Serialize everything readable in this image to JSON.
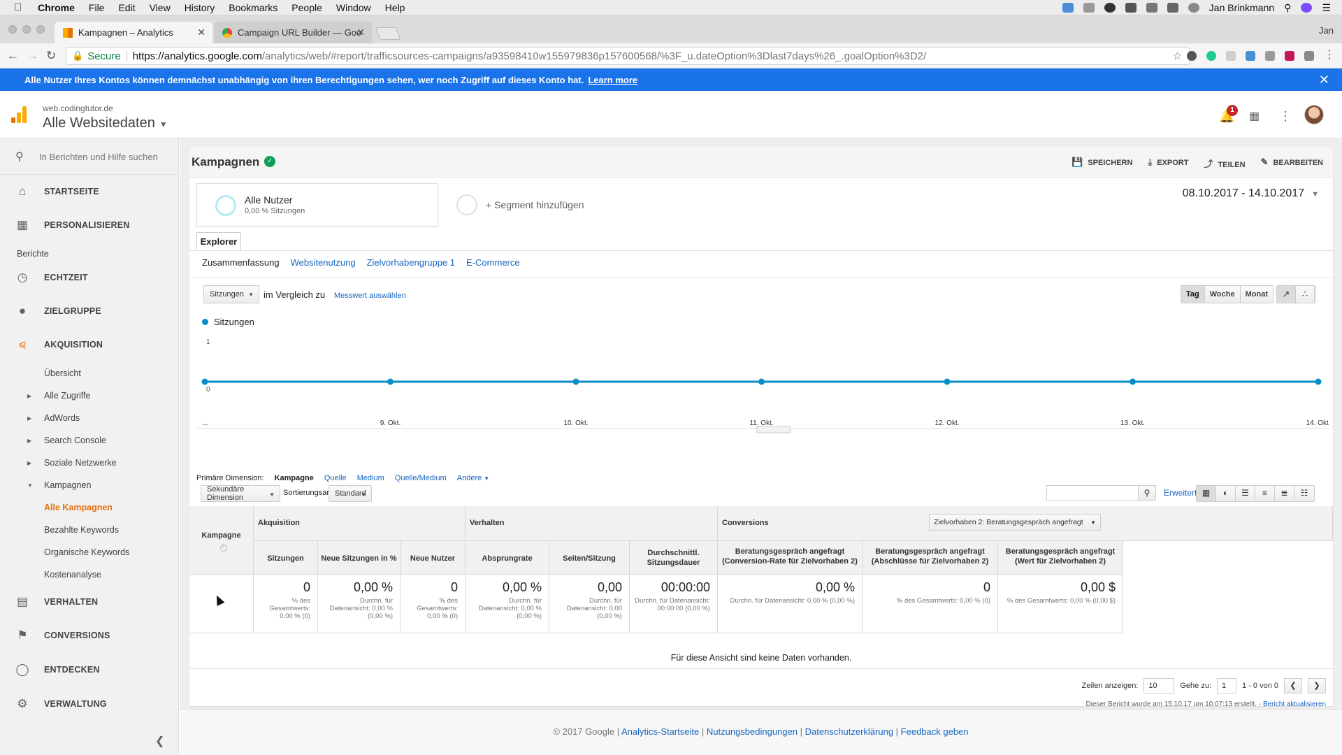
{
  "mac_menu": {
    "apple": "",
    "items": [
      "Chrome",
      "File",
      "Edit",
      "View",
      "History",
      "Bookmarks",
      "People",
      "Window",
      "Help"
    ],
    "user": "Jan Brinkmann"
  },
  "browser": {
    "tabs": [
      {
        "title": "Kampagnen – Analytics",
        "active": true
      },
      {
        "title": "Campaign URL Builder — Goo",
        "active": false
      }
    ],
    "profile": "Jan",
    "secure_label": "Secure",
    "url_host": "https://analytics.google.com",
    "url_path": "/analytics/web/#report/trafficsources-campaigns/a93598410w155979836p157600568/%3F_u.dateOption%3Dlast7days%26_.goalOption%3D2/"
  },
  "infobar": {
    "text": "Alle Nutzer Ihres Kontos können demnächst unabhängig von ihren Berechtigungen sehen, wer noch Zugriff auf dieses Konto hat.",
    "link": "Learn more"
  },
  "header": {
    "property": "web.codingtutor.de",
    "view": "Alle Websitedaten",
    "notifications": "1"
  },
  "sidebar": {
    "search_placeholder": "In Berichten und Hilfe suchen",
    "top_items": [
      {
        "label": "STARTSEITE",
        "icon": "home-icon"
      },
      {
        "label": "PERSONALISIEREN",
        "icon": "grid-icon"
      }
    ],
    "section_label": "Berichte",
    "report_items": [
      {
        "label": "ECHTZEIT",
        "icon": "clock-icon"
      },
      {
        "label": "ZIELGRUPPE",
        "icon": "person-icon"
      },
      {
        "label": "AKQUISITION",
        "icon": "acquisition-icon"
      }
    ],
    "acq_sub": [
      "Übersicht",
      "Alle Zugriffe",
      "AdWords",
      "Search Console",
      "Soziale Netzwerke",
      "Kampagnen"
    ],
    "campaign_sub": [
      "Alle Kampagnen",
      "Bezahlte Keywords",
      "Organische Keywords",
      "Kostenanalyse"
    ],
    "bottom_items": [
      {
        "label": "VERHALTEN",
        "icon": "behavior-icon"
      },
      {
        "label": "CONVERSIONS",
        "icon": "flag-icon"
      },
      {
        "label": "ENTDECKEN",
        "icon": "lightbulb-icon"
      },
      {
        "label": "VERWALTUNG",
        "icon": "gear-icon"
      }
    ]
  },
  "report": {
    "title": "Kampagnen",
    "actions": {
      "save": "SPEICHERN",
      "export": "EXPORT",
      "share": "TEILEN",
      "edit": "BEARBEITEN"
    },
    "segment": {
      "name": "Alle Nutzer",
      "sub": "0,00 % Sitzungen"
    },
    "add_segment": "+ Segment hinzufügen",
    "date_range": "08.10.2017 - 14.10.2017",
    "explorer_tab": "Explorer",
    "subtabs": [
      "Zusammenfassung",
      "Websitenutzung",
      "Zielvorhabengruppe 1",
      "E-Commerce"
    ],
    "metric_select": "Sitzungen",
    "compare_text": "im Vergleich zu",
    "compare_link": "Messwert auswählen",
    "granularity": [
      "Tag",
      "Woche",
      "Monat"
    ],
    "granularity_active": "Tag",
    "primary_dimension": {
      "label": "Primäre Dimension:",
      "options": [
        "Kampagne",
        "Quelle",
        "Medium",
        "Quelle/Medium",
        "Andere"
      ],
      "active": "Kampagne"
    },
    "secondary_dimension": "Sekundäre Dimension",
    "sort_label": "Sortierungsart:",
    "sort_value": "Standard",
    "advanced_link": "Erweitert"
  },
  "chart_data": {
    "type": "line",
    "series": [
      {
        "name": "Sitzungen",
        "values": [
          0,
          0,
          0,
          0,
          0,
          0,
          0
        ]
      }
    ],
    "x": [
      "...",
      "9. Okt.",
      "10. Okt.",
      "11. Okt.",
      "12. Okt.",
      "13. Okt.",
      "14. Okt."
    ],
    "ytick_top": "1",
    "ytick_bottom": "0",
    "ylim": [
      0,
      1
    ],
    "color": "#058dc7"
  },
  "table": {
    "dim_header": "Kampagne",
    "groups": {
      "acq": "Akquisition",
      "beh": "Verhalten",
      "conv": "Conversions"
    },
    "conversion_select": "Zielvorhaben 2: Beratungsgespräch angefragt",
    "columns": [
      {
        "label": "Sitzungen",
        "value": "0",
        "sub": "% des Gesamtwerts: 0,00 % (0)"
      },
      {
        "label": "Neue Sitzungen in %",
        "value": "0,00 %",
        "sub": "Durchn. für Datenansicht: 0,00 % (0,00 %)"
      },
      {
        "label": "Neue Nutzer",
        "value": "0",
        "sub": "% des Gesamtwerts: 0,00 % (0)"
      },
      {
        "label": "Absprungrate",
        "value": "0,00 %",
        "sub": "Durchn. für Datenansicht: 0,00 % (0,00 %)"
      },
      {
        "label": "Seiten/Sitzung",
        "value": "0,00",
        "sub": "Durchn. für Datenansicht: 0,00 (0,00 %)"
      },
      {
        "label": "Durchschnittl. Sitzungsdauer",
        "value": "00:00:00",
        "sub": "Durchn. für Datenansicht: 00:00:00 (0,00 %)"
      },
      {
        "label": "Beratungsgespräch angefragt (Conversion-Rate für Zielvorhaben 2)",
        "value": "0,00 %",
        "sub": "Durchn. für Datenansicht: 0,00 % (0,00 %)"
      },
      {
        "label": "Beratungsgespräch angefragt (Abschlüsse für Zielvorhaben 2)",
        "value": "0",
        "sub": "% des Gesamtwerts: 0,00 % (0)"
      },
      {
        "label": "Beratungsgespräch angefragt (Wert für Zielvorhaben 2)",
        "value": "0,00 $",
        "sub": "% des Gesamtwerts: 0,00 % (0,00 $)"
      }
    ],
    "no_data": "Für diese Ansicht sind keine Daten vorhanden."
  },
  "pager": {
    "rows_label": "Zeilen anzeigen:",
    "rows_value": "10",
    "goto_label": "Gehe zu:",
    "goto_value": "1",
    "range": "1 - 0 von 0"
  },
  "report_info": {
    "text": "Dieser Bericht wurde am 15.10.17 um 10:07:13 erstellt. -",
    "link": "Bericht aktualisieren"
  },
  "footer": {
    "copyright": "© 2017 Google",
    "links": [
      "Analytics-Startseite",
      "Nutzungsbedingungen",
      "Datenschutzerklärung",
      "Feedback geben"
    ]
  }
}
